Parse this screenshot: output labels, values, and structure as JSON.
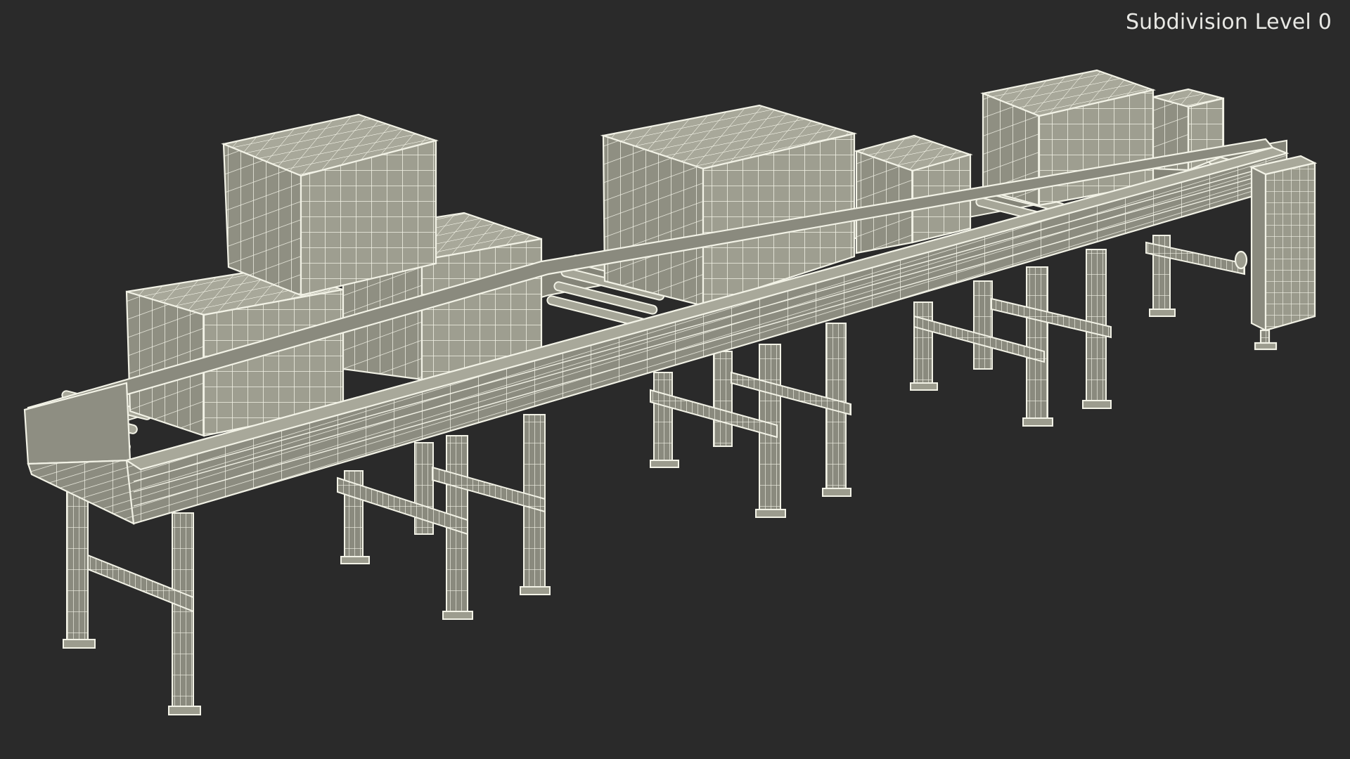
{
  "viewport": {
    "label": "Subdivision Level 0",
    "background_color": "#2a2a2a",
    "model_fill_color": "#9c9c8e",
    "wire_color": "#f2f2e6"
  },
  "scene": {
    "objects": [
      "box-front-left",
      "box-back-left",
      "box-top-left",
      "box-center-large",
      "box-center-right",
      "box-right-large",
      "box-right-small",
      "conveyor-frame",
      "rollers",
      "support-legs",
      "end-control-panel"
    ]
  }
}
